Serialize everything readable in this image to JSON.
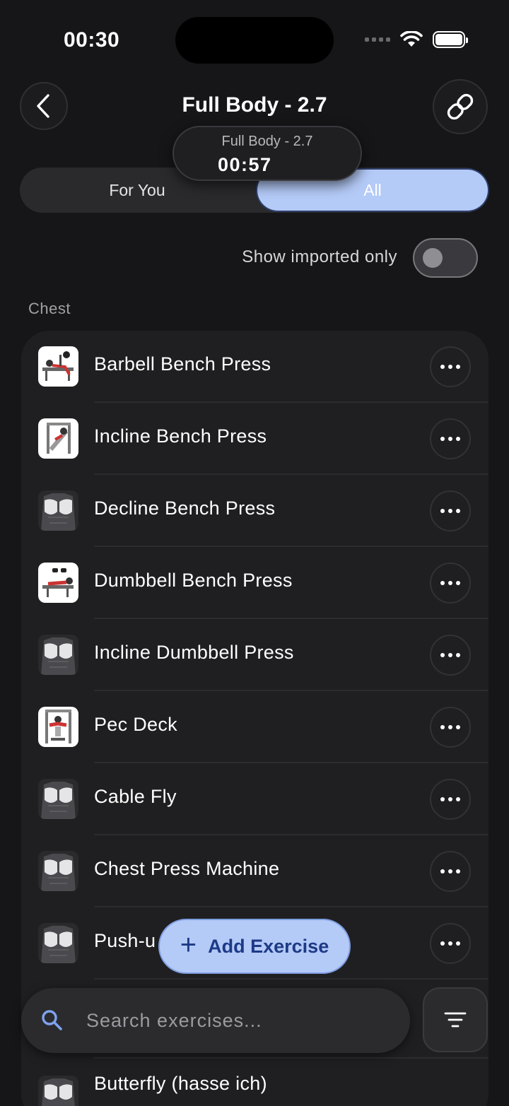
{
  "status_bar": {
    "time": "00:30"
  },
  "header": {
    "title": "Full Body - 2.7"
  },
  "timer": {
    "workout_name": "Full Body - 2.7",
    "elapsed": "00:57"
  },
  "tabs": [
    {
      "label": "For You",
      "selected": false
    },
    {
      "label": "All",
      "selected": true
    }
  ],
  "filter_toggle": {
    "label": "Show imported only",
    "on": false
  },
  "section": {
    "title": "Chest"
  },
  "exercises": [
    {
      "name": "Barbell Bench Press",
      "thumb": "photo"
    },
    {
      "name": "Incline Bench Press",
      "thumb": "photo"
    },
    {
      "name": "Decline Bench Press",
      "thumb": "muscle"
    },
    {
      "name": "Dumbbell Bench Press",
      "thumb": "photo"
    },
    {
      "name": "Incline Dumbbell Press",
      "thumb": "muscle"
    },
    {
      "name": "Pec Deck",
      "thumb": "photo"
    },
    {
      "name": "Cable Fly",
      "thumb": "muscle"
    },
    {
      "name": "Chest Press Machine",
      "thumb": "muscle"
    },
    {
      "name": "Push-u",
      "thumb": "muscle"
    },
    {
      "name": "Butterfly (hasse ich)",
      "thumb": "muscle"
    }
  ],
  "add_button": {
    "label": "Add Exercise"
  },
  "search": {
    "placeholder": "Search exercises..."
  },
  "colors": {
    "accent": "#b4caf7",
    "accent_text": "#1c3a86",
    "background": "#161618",
    "card": "#1f1f21"
  },
  "icons": [
    "back-chevron-icon",
    "link-icon",
    "more-icon",
    "search-icon",
    "filter-icon",
    "plus-icon"
  ]
}
